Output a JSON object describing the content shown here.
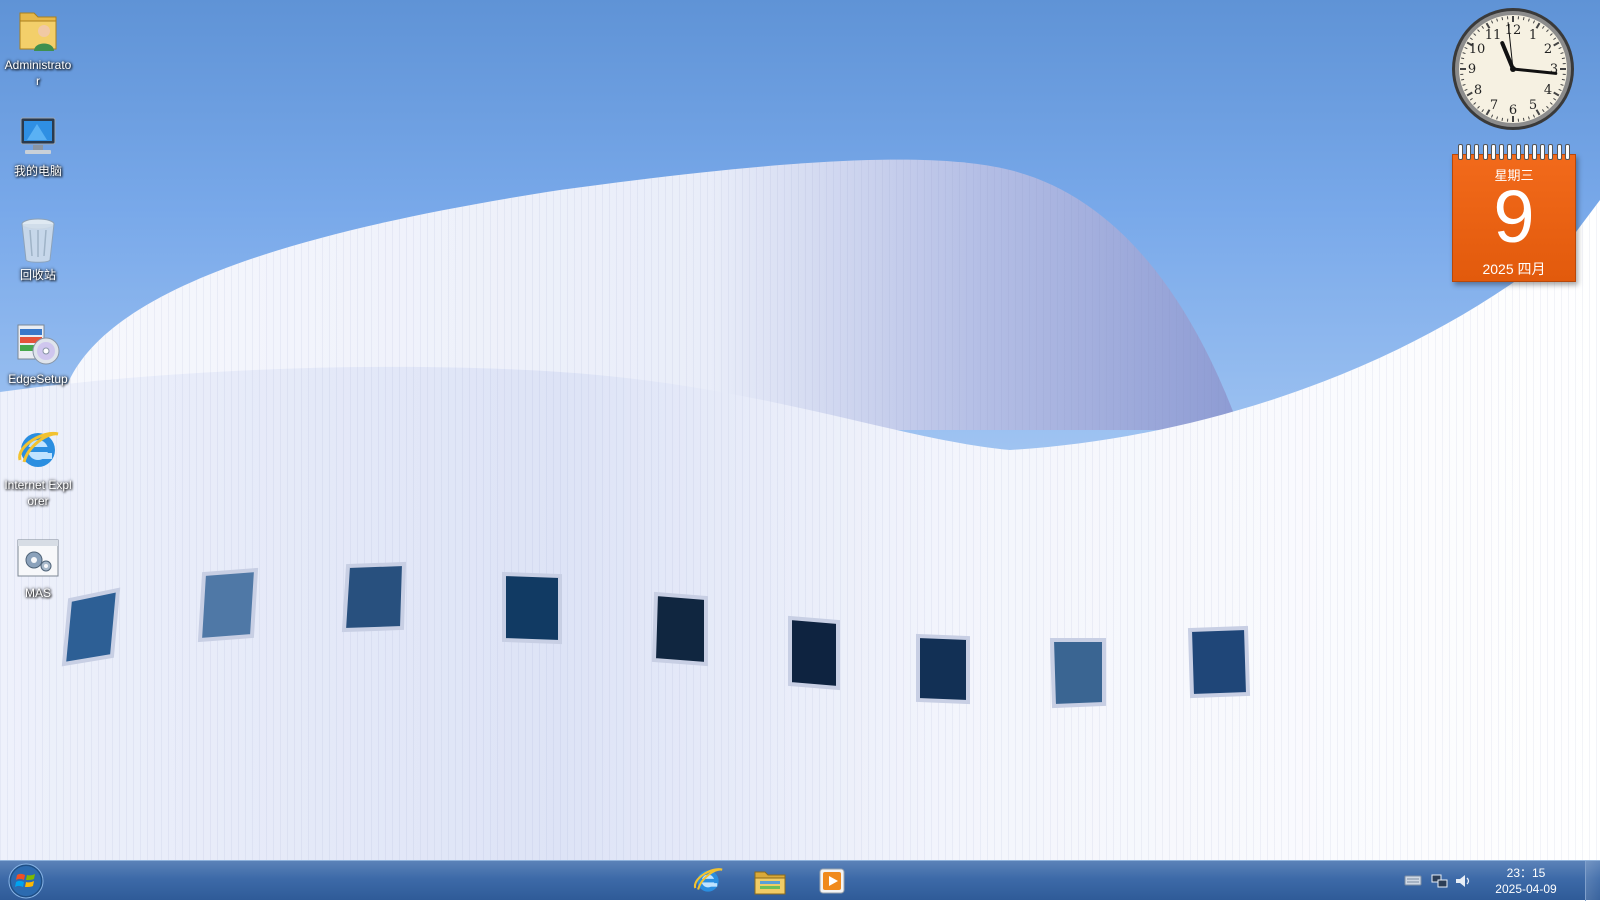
{
  "desktop": {
    "icons": [
      {
        "label": "Administrator"
      },
      {
        "label": "我的电脑"
      },
      {
        "label": "回收站"
      },
      {
        "label": "EdgeSetup"
      },
      {
        "label": "Internet Explorer"
      },
      {
        "label": "MAS"
      }
    ]
  },
  "gadgets": {
    "clock": {
      "hour": 11,
      "minute": 15,
      "second": 59
    },
    "calendar": {
      "weekday": "星期三",
      "day": "9",
      "month_year": "2025 四月"
    }
  },
  "taskbar": {
    "pinned": [
      {
        "icon": "internet-explorer-icon"
      },
      {
        "icon": "file-explorer-icon"
      },
      {
        "icon": "media-player-icon"
      }
    ],
    "tray": {
      "time": "23：15",
      "date": "2025-04-09",
      "icons": [
        "keyboard-icon",
        "network-icon",
        "volume-icon"
      ]
    }
  },
  "colors": {
    "taskbar": "#3d6aa8",
    "calendar": "#e25a0c",
    "sky": "#79a9ea"
  }
}
